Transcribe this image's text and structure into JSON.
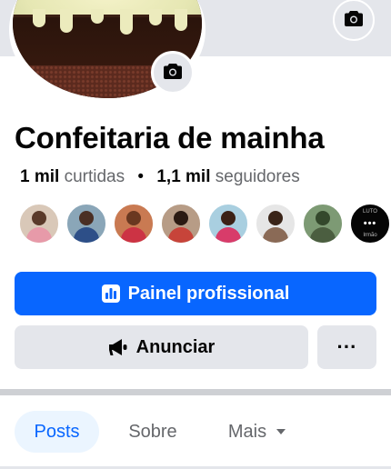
{
  "page": {
    "name": "Confeitaria de mainha"
  },
  "stats": {
    "likes_count": "1 mil",
    "likes_label": "curtidas",
    "separator": "•",
    "followers_count": "1,1 mil",
    "followers_label": "seguidores"
  },
  "followers_preview": {
    "more_tag_top": "LUTO",
    "more_tag_bottom": "Irmão",
    "more_label": "•••"
  },
  "actions": {
    "primary_label": "Painel profissional",
    "secondary_label": "Anunciar",
    "more_label": "···"
  },
  "tabs": {
    "posts": "Posts",
    "about": "Sobre",
    "more": "Mais"
  },
  "icons": {
    "cover_camera": "camera-icon",
    "avatar_camera": "camera-icon",
    "dashboard": "dashboard-icon",
    "megaphone": "megaphone-icon",
    "caret": "caret-down-icon"
  },
  "colors": {
    "brand_blue": "#0866ff",
    "button_gray": "#e4e6eb",
    "tab_active_bg": "#ebf5ff",
    "secondary_text": "#65676b"
  }
}
